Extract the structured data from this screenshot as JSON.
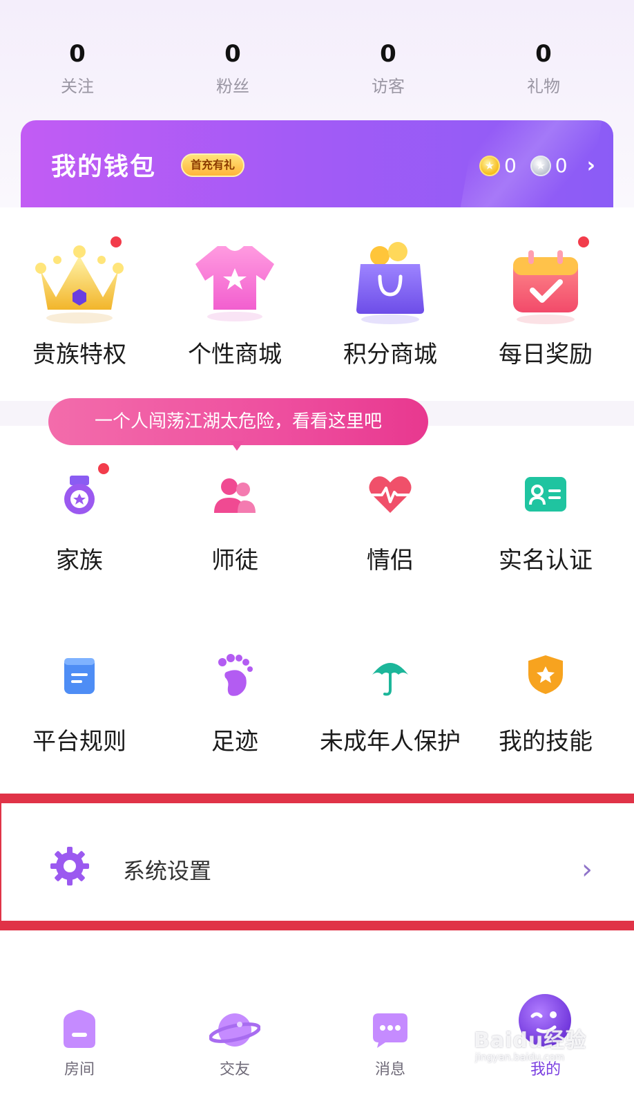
{
  "stats": [
    {
      "value": "0",
      "label": "关注"
    },
    {
      "value": "0",
      "label": "粉丝"
    },
    {
      "value": "0",
      "label": "访客"
    },
    {
      "value": "0",
      "label": "礼物"
    }
  ],
  "wallet": {
    "title": "我的钱包",
    "badge": "首充有礼",
    "gold_coins": "0",
    "silver_coins": "0",
    "gradient_start": "#c25cf4",
    "gradient_end": "#8b5cf6"
  },
  "features": [
    {
      "label": "贵族特权",
      "icon": "crown-icon",
      "has_dot": true
    },
    {
      "label": "个性商城",
      "icon": "tshirt-icon",
      "has_dot": false
    },
    {
      "label": "积分商城",
      "icon": "shopping-bag-icon",
      "has_dot": false
    },
    {
      "label": "每日奖励",
      "icon": "calendar-check-icon",
      "has_dot": true
    }
  ],
  "tooltip": {
    "text": "一个人闯荡江湖太危险，看看这里吧"
  },
  "services": [
    {
      "label": "家族",
      "icon": "family-medal-icon",
      "has_dot": true
    },
    {
      "label": "师徒",
      "icon": "people-icon",
      "has_dot": false
    },
    {
      "label": "情侣",
      "icon": "heartbeat-icon",
      "has_dot": false
    },
    {
      "label": "实名认证",
      "icon": "id-card-icon",
      "has_dot": false
    },
    {
      "label": "平台规则",
      "icon": "document-icon",
      "has_dot": false
    },
    {
      "label": "足迹",
      "icon": "footprint-icon",
      "has_dot": false
    },
    {
      "label": "未成年人保护",
      "icon": "umbrella-icon",
      "has_dot": false
    },
    {
      "label": "我的技能",
      "icon": "shield-star-icon",
      "has_dot": false
    }
  ],
  "settings": {
    "label": "系统设置",
    "icon": "gear-icon",
    "highlight_color": "#e03347"
  },
  "bottom_nav": [
    {
      "label": "房间",
      "icon": "room-icon",
      "active": false
    },
    {
      "label": "交友",
      "icon": "planet-icon",
      "active": false
    },
    {
      "label": "消息",
      "icon": "chat-icon",
      "active": false
    },
    {
      "label": "我的",
      "icon": "face-icon",
      "active": true
    }
  ],
  "watermark": {
    "text": "Baidu经验",
    "sub": "jingyan.baidu.com"
  }
}
